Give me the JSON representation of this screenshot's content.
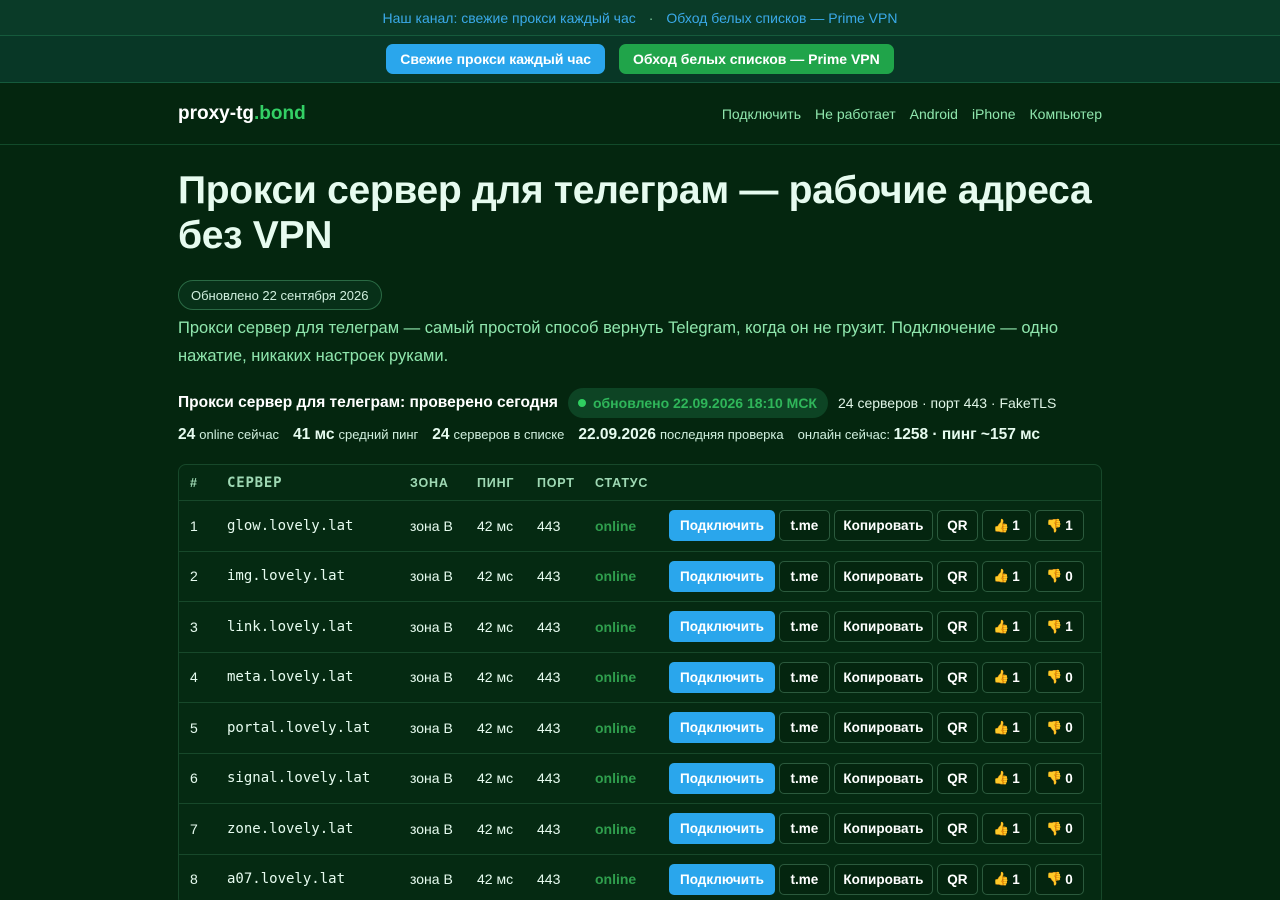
{
  "topbar": {
    "link1": "Наш канал: свежие прокси каждый час",
    "separator": "·",
    "link2": "Обход белых списков — Prime VPN"
  },
  "buttons": {
    "fresh": "Свежие прокси каждый час",
    "prime": "Обход белых списков — Prime VPN"
  },
  "header": {
    "logo_main": "proxy-tg",
    "logo_accent": ".bond",
    "nav": [
      "Подключить",
      "Не работает",
      "Android",
      "iPhone",
      "Компьютер"
    ]
  },
  "main": {
    "title": "Прокси сервер для телеграм — рабочие адреса без VPN",
    "updated": "Обновлено 22 сентября 2026",
    "lead": "Прокси сервер для телеграм — самый простой способ вернуть Telegram, когда он не грузит. Подключение — одно нажатие, никаких настроек руками.",
    "status_title": "Прокси сервер для телеграм: проверено сегодня",
    "status_badge": "обновлено 22.09.2026 18:10 МСК",
    "status_meta": "24 серверов · порт 443 · FakeTLS",
    "stats": {
      "online_value": "24",
      "online_label": "online сейчас",
      "ping_value": "41 мс",
      "ping_label": "средний пинг",
      "servers_value": "24",
      "servers_label": "серверов в списке",
      "date_value": "22.09.2026",
      "date_label": "последняя проверка",
      "live_label": "онлайн сейчас:",
      "live_value": "1258 · пинг ~157 мс"
    }
  },
  "table": {
    "headers": [
      "#",
      "СЕРВЕР",
      "ЗОНА",
      "ПИНГ",
      "ПОРТ",
      "СТАТУС"
    ],
    "actions": {
      "connect": "Подключить",
      "tme": "t.me",
      "copy": "Копировать",
      "qr": "QR",
      "up_icon": "👍",
      "down_icon": "👎"
    },
    "rows": [
      {
        "num": "1",
        "host": "glow.lovely.lat",
        "zone": "зона B",
        "ping": "42 мс",
        "port": "443",
        "status": "online",
        "up": "1",
        "down": "1"
      },
      {
        "num": "2",
        "host": "img.lovely.lat",
        "zone": "зона B",
        "ping": "42 мс",
        "port": "443",
        "status": "online",
        "up": "1",
        "down": "0"
      },
      {
        "num": "3",
        "host": "link.lovely.lat",
        "zone": "зона B",
        "ping": "42 мс",
        "port": "443",
        "status": "online",
        "up": "1",
        "down": "1"
      },
      {
        "num": "4",
        "host": "meta.lovely.lat",
        "zone": "зона B",
        "ping": "42 мс",
        "port": "443",
        "status": "online",
        "up": "1",
        "down": "0"
      },
      {
        "num": "5",
        "host": "portal.lovely.lat",
        "zone": "зона B",
        "ping": "42 мс",
        "port": "443",
        "status": "online",
        "up": "1",
        "down": "0"
      },
      {
        "num": "6",
        "host": "signal.lovely.lat",
        "zone": "зона B",
        "ping": "42 мс",
        "port": "443",
        "status": "online",
        "up": "1",
        "down": "0"
      },
      {
        "num": "7",
        "host": "zone.lovely.lat",
        "zone": "зона B",
        "ping": "42 мс",
        "port": "443",
        "status": "online",
        "up": "1",
        "down": "0"
      },
      {
        "num": "8",
        "host": "a07.lovely.lat",
        "zone": "зона B",
        "ping": "42 мс",
        "port": "443",
        "status": "online",
        "up": "1",
        "down": "0"
      }
    ]
  }
}
